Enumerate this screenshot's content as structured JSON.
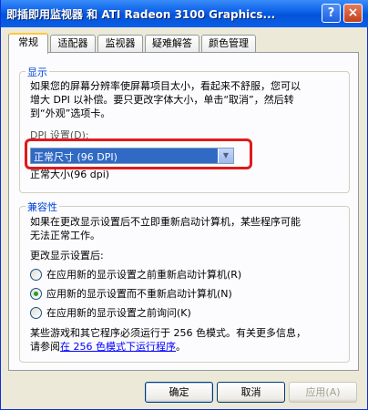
{
  "window": {
    "title": "即插即用监视器 和 ATI Radeon 3100 Graphics...",
    "help_label": "?",
    "close_label": "×"
  },
  "tabs": [
    {
      "label": "常规"
    },
    {
      "label": "适配器"
    },
    {
      "label": "监视器"
    },
    {
      "label": "疑难解答"
    },
    {
      "label": "颜色管理"
    }
  ],
  "display": {
    "group_title": "显示",
    "description": [
      "如果您的屏幕分辨率使屏幕项目太小，看起来不舒服，您可以",
      "增大 DPI 以补偿。要只更改字体大小，单击“取消”，然后转",
      "到“外观”选项卡。"
    ],
    "dpi_label": "DPI 设置(D):",
    "dpi_value": "正常尺寸 (96 DPI)",
    "dpi_hint": "正常大小(96 dpi)"
  },
  "compat": {
    "group_title": "兼容性",
    "description": [
      "如果在更改显示设置后不立即重新启动计算机，某些程序可能",
      "无法正常工作。"
    ],
    "after_change_label": "更改显示设置后:",
    "options": [
      {
        "label": "在应用新的显示设置之前重新启动计算机(R)",
        "checked": false
      },
      {
        "label": "应用新的显示设置而不重新启动计算机(N)",
        "checked": true
      },
      {
        "label": "在应用新的显示设置之前询问(K)",
        "checked": false
      }
    ],
    "footer_line1": "某些游戏和其它程序必须运行于 256 色模式。有关更多信息，",
    "footer_prefix": "请参阅",
    "footer_link": "在 256 色模式下运行程序",
    "footer_suffix": "。"
  },
  "buttons": {
    "ok": "确定",
    "cancel": "取消",
    "apply": "应用(A)"
  }
}
